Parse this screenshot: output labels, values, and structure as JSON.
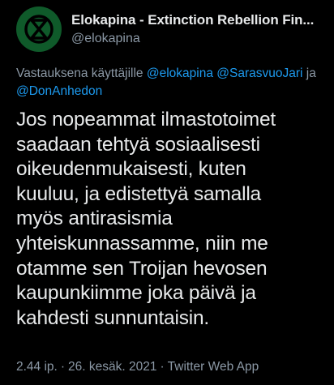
{
  "tweet": {
    "author": {
      "display_name": "Elokapina - Extinction Rebellion Fin...",
      "handle": "@elokapina",
      "avatar_icon": "extinction-symbol-icon",
      "avatar_color": "#0f5a2a"
    },
    "reply": {
      "prefix": "Vastauksena käyttäjille",
      "mentions": [
        "@elokapina",
        "@SarasvuoJari",
        "@DonAnhedon"
      ],
      "conjunction": "ja"
    },
    "body_lines": [
      "Jos nopeammat ilmastotoimet",
      "saadaan tehtyä sosiaalisesti",
      "oikeudenmukaisesti, kuten",
      "kuuluu, ja edistettyä samalla",
      "myös antirasismia",
      "yhteiskunnassamme, niin me",
      "otamme sen Troijan hevosen",
      "kaupunkiimme joka päivä ja",
      "kahdesti sunnuntaisin."
    ],
    "meta": {
      "time": "2.44 ip.",
      "date": "26. kesäk. 2021",
      "source": "Twitter Web App",
      "separator": "·"
    }
  },
  "colors": {
    "background": "#000000",
    "text": "#e7e9ea",
    "secondary": "#8b98a5",
    "link": "#1d9bf0"
  }
}
